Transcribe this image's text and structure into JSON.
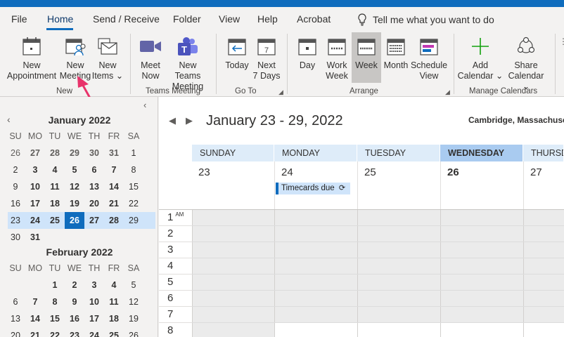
{
  "menu": {
    "tabs": [
      "File",
      "Home",
      "Send / Receive",
      "Folder",
      "View",
      "Help",
      "Acrobat"
    ],
    "tell_me": "Tell me what you want to do"
  },
  "ribbon": {
    "new_appointment": [
      "New",
      "Appointment"
    ],
    "new_meeting": [
      "New",
      "Meeting"
    ],
    "new_items": [
      "New",
      "Items ⌄"
    ],
    "meet_now": [
      "Meet",
      "Now"
    ],
    "new_teams_meeting": [
      "New Teams",
      "Meeting"
    ],
    "today": [
      "Today",
      ""
    ],
    "next_7_days": [
      "Next",
      "7 Days"
    ],
    "day": [
      "Day",
      ""
    ],
    "work_week": [
      "Work",
      "Week"
    ],
    "week": [
      "Week",
      ""
    ],
    "month": [
      "Month",
      ""
    ],
    "schedule_view": [
      "Schedule",
      "View"
    ],
    "add_calendar": [
      "Add",
      "Calendar ⌄"
    ],
    "share_calendar": [
      "Share",
      "Calendar ⌄"
    ],
    "groups": {
      "new": "New",
      "teams_meeting": "Teams Meeting",
      "go_to": "Go To",
      "arrange": "Arrange",
      "manage_calendars": "Manage Calendars"
    }
  },
  "mini_calendars": [
    {
      "title": "January 2022",
      "weekdays": [
        "SU",
        "MO",
        "TU",
        "WE",
        "TH",
        "FR",
        "SA"
      ],
      "weeks": [
        [
          "26",
          "27",
          "28",
          "29",
          "30",
          "31",
          "1"
        ],
        [
          "2",
          "3",
          "4",
          "5",
          "6",
          "7",
          "8"
        ],
        [
          "9",
          "10",
          "11",
          "12",
          "13",
          "14",
          "15"
        ],
        [
          "16",
          "17",
          "18",
          "19",
          "20",
          "21",
          "22"
        ],
        [
          "23",
          "24",
          "25",
          "26",
          "27",
          "28",
          "29"
        ],
        [
          "30",
          "31",
          "",
          "",
          "",
          "",
          ""
        ]
      ]
    },
    {
      "title": "February 2022",
      "weekdays": [
        "SU",
        "MO",
        "TU",
        "WE",
        "TH",
        "FR",
        "SA"
      ],
      "weeks": [
        [
          "",
          "",
          "1",
          "2",
          "3",
          "4",
          "5"
        ],
        [
          "6",
          "7",
          "8",
          "9",
          "10",
          "11",
          "12"
        ],
        [
          "13",
          "14",
          "15",
          "16",
          "17",
          "18",
          "19"
        ],
        [
          "20",
          "21",
          "22",
          "23",
          "24",
          "25",
          "26"
        ]
      ]
    }
  ],
  "calendar": {
    "range_title": "January 23 - 29, 2022",
    "location": "Cambridge, Massachusett",
    "days": [
      {
        "name": "SUNDAY",
        "date": "23"
      },
      {
        "name": "MONDAY",
        "date": "24"
      },
      {
        "name": "TUESDAY",
        "date": "25"
      },
      {
        "name": "WEDNESDAY",
        "date": "26"
      },
      {
        "name": "THURSDA",
        "date": "27"
      }
    ],
    "event": "Timecards due",
    "hours": [
      "1",
      "2",
      "3",
      "4",
      "5",
      "6",
      "7",
      "8"
    ],
    "first_hour_suffix": "AM"
  },
  "colors": {
    "accent": "#0f6cbd",
    "arrow": "#e8336b"
  }
}
